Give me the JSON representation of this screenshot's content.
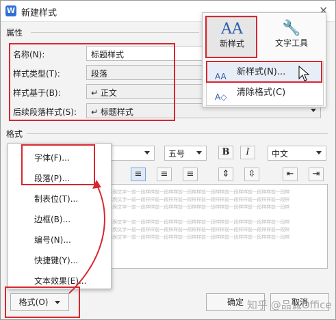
{
  "window": {
    "title": "新建样式",
    "app_icon_text": "W",
    "close_glyph": "×"
  },
  "sections": {
    "properties": "属性",
    "format": "格式"
  },
  "properties": [
    {
      "label": "名称(N):",
      "value": "标题样式"
    },
    {
      "label": "样式类型(T):",
      "value": "段落"
    },
    {
      "label": "样式基于(B):",
      "value": "↵ 正文"
    },
    {
      "label": "后续段落样式(S):",
      "value": "↵ 标题样式"
    }
  ],
  "toolbar_popup": {
    "new_style_btn": "新样式",
    "text_tools_btn": "文字工具",
    "menu": [
      {
        "label": "新样式(N)...",
        "icon": "new-style-icon"
      },
      {
        "label": "清除格式(C)",
        "icon": "clear-format-icon"
      }
    ]
  },
  "format_toolbar": {
    "font_size": "五号",
    "bold": "B",
    "italic": "I",
    "language": "中文"
  },
  "format_menu": {
    "items": [
      "字体(F)...",
      "段落(P)...",
      "制表位(T)...",
      "边框(B)...",
      "编号(N)...",
      "快捷键(Y)...",
      "文本效果(E)..."
    ]
  },
  "buttons": {
    "format": "格式(O)",
    "ok": "确定",
    "cancel": "取消"
  },
  "preview_text": "示例文字一前一段样样前一段样样前一段样样前一段样样前一段样样前一段样样前一段样",
  "watermark": "知乎 @品诚Office",
  "colors": {
    "highlight": "#d9262e",
    "accent": "#2f6fd6"
  }
}
